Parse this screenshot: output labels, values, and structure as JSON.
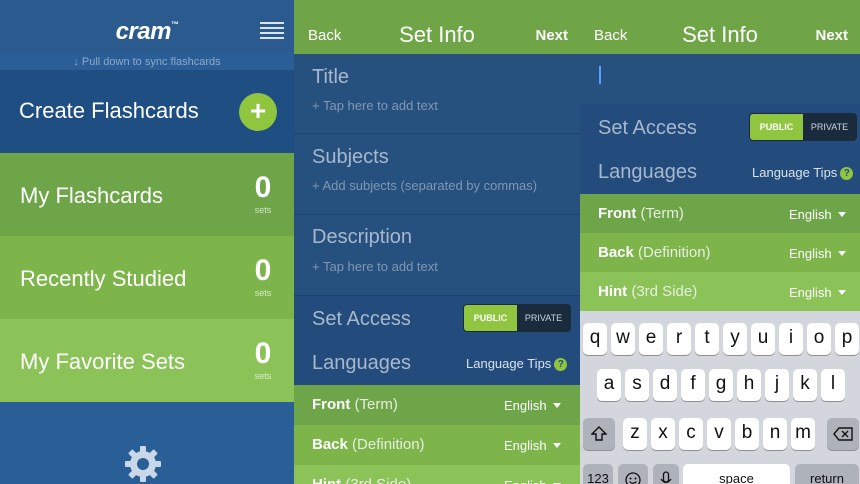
{
  "home": {
    "logo": "cram",
    "logo_tm": "™",
    "pull_hint": "↓ Pull down to sync flashcards",
    "create_label": "Create Flashcards",
    "plus_symbol": "+",
    "menu": [
      {
        "label": "My Flashcards",
        "count": "0",
        "unit": "sets"
      },
      {
        "label": "Recently Studied",
        "count": "0",
        "unit": "sets"
      },
      {
        "label": "My Favorite Sets",
        "count": "0",
        "unit": "sets"
      }
    ]
  },
  "set_info": {
    "back": "Back",
    "title": "Set Info",
    "next": "Next",
    "fields": {
      "title_label": "Title",
      "title_hint": "+ Tap here to add text",
      "subjects_label": "Subjects",
      "subjects_hint": "+ Add subjects (separated by commas)",
      "description_label": "Description",
      "description_hint": "+ Tap here to add text"
    },
    "access_label": "Set Access",
    "access_public": "PUBLIC",
    "access_private": "PRIVATE",
    "languages_label": "Languages",
    "language_tips": "Language Tips",
    "help_symbol": "?",
    "sides": [
      {
        "name": "Front",
        "detail": "(Term)",
        "language": "English"
      },
      {
        "name": "Back",
        "detail": "(Definition)",
        "language": "English"
      },
      {
        "name": "Hint",
        "detail": "(3rd Side)",
        "language": "English"
      }
    ]
  },
  "keyboard": {
    "row1": [
      "q",
      "w",
      "e",
      "r",
      "t",
      "y",
      "u",
      "i",
      "o",
      "p"
    ],
    "row2": [
      "a",
      "s",
      "d",
      "f",
      "g",
      "h",
      "j",
      "k",
      "l"
    ],
    "row3": [
      "z",
      "x",
      "c",
      "v",
      "b",
      "n",
      "m"
    ],
    "numbers_key": "123",
    "space_key": "space",
    "return_key": "return"
  },
  "colors": {
    "header_green": "#6fa547",
    "accent_green": "#8fc53f",
    "navy": "#234c7c"
  }
}
